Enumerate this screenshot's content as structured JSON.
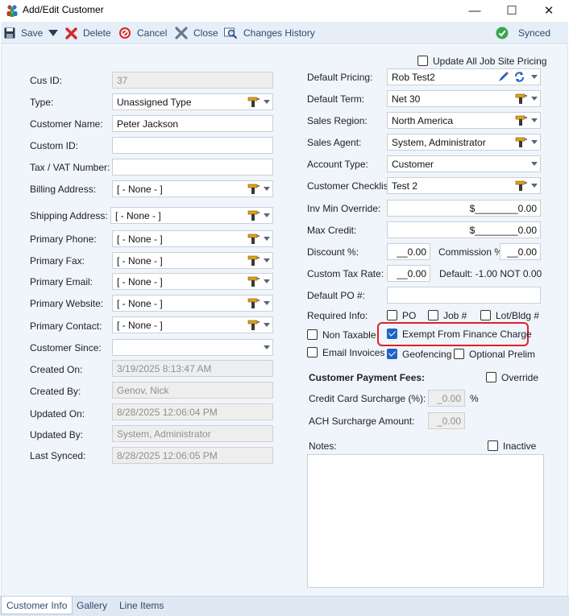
{
  "window": {
    "title": "Add/Edit Customer",
    "minimize_glyph": "—",
    "maximize_glyph": "☐",
    "close_glyph": "✕"
  },
  "toolbar": {
    "save": "Save",
    "delete": "Delete",
    "cancel": "Cancel",
    "close": "Close",
    "changes_history": "Changes History",
    "status": "Synced"
  },
  "update_all_job_site_pricing": {
    "label": "Update All Job Site Pricing",
    "checked": false
  },
  "left": {
    "cus_id": {
      "label": "Cus ID:",
      "value": "37"
    },
    "type": {
      "label": "Type:",
      "value": "Unassigned Type"
    },
    "customer_name": {
      "label": "Customer Name:",
      "value": "Peter Jackson"
    },
    "custom_id": {
      "label": "Custom ID:",
      "value": ""
    },
    "tax_vat": {
      "label": "Tax / VAT Number:",
      "value": ""
    },
    "billing_address": {
      "label": "Billing Address:",
      "value": "[ - None - ]"
    },
    "shipping_address": {
      "label": "Shipping Address:",
      "value": "[ - None - ]"
    },
    "primary_phone": {
      "label": "Primary Phone:",
      "value": "[ - None - ]"
    },
    "primary_fax": {
      "label": "Primary Fax:",
      "value": "[ - None - ]"
    },
    "primary_email": {
      "label": "Primary Email:",
      "value": "[ - None - ]"
    },
    "primary_website": {
      "label": "Primary Website:",
      "value": "[ - None - ]"
    },
    "primary_contact": {
      "label": "Primary Contact:",
      "value": "[ - None - ]"
    },
    "customer_since": {
      "label": "Customer Since:",
      "value": ""
    },
    "created_on": {
      "label": "Created On:",
      "value": "3/19/2025 8:13:47 AM"
    },
    "created_by": {
      "label": "Created By:",
      "value": "Genov, Nick"
    },
    "updated_on": {
      "label": "Updated On:",
      "value": "8/28/2025 12:06:04 PM"
    },
    "updated_by": {
      "label": "Updated By:",
      "value": "System, Administrator"
    },
    "last_synced": {
      "label": "Last Synced:",
      "value": "8/28/2025 12:06:05 PM"
    }
  },
  "right": {
    "default_pricing": {
      "label": "Default Pricing:",
      "value": "Rob Test2"
    },
    "default_term": {
      "label": "Default Term:",
      "value": "Net 30"
    },
    "sales_region": {
      "label": "Sales Region:",
      "value": "North America"
    },
    "sales_agent": {
      "label": "Sales Agent:",
      "value": "System, Administrator"
    },
    "account_type": {
      "label": "Account Type:",
      "value": "Customer"
    },
    "customer_checklist": {
      "label": "Customer Checklist:",
      "value": "Test 2"
    },
    "inv_min_override": {
      "label": "Inv Min Override:",
      "value": "$________0.00"
    },
    "max_credit": {
      "label": "Max Credit:",
      "value": "$________0.00"
    },
    "discount": {
      "label": "Discount %:",
      "value": "__0.00"
    },
    "commission": {
      "label": "Commission %:",
      "value": "__0.00"
    },
    "custom_tax_rate": {
      "label": "Custom Tax Rate:",
      "value": "__0.00",
      "default_note": "Default: -1.00 NOT 0.00"
    },
    "default_po": {
      "label": "Default PO #:",
      "value": ""
    },
    "required_info": {
      "label": "Required Info:",
      "po": "PO",
      "job": "Job #",
      "lot": "Lot/Bldg #",
      "po_checked": false,
      "job_checked": false,
      "lot_checked": false
    },
    "non_taxable": {
      "label": "Non Taxable",
      "checked": false
    },
    "exempt_finance": {
      "label": "Exempt From Finance Charge",
      "checked": true
    },
    "email_invoices": {
      "label": "Email Invoices",
      "checked": false
    },
    "geofencing": {
      "label": "Geofencing",
      "checked": true
    },
    "optional_prelim": {
      "label": "Optional Prelim",
      "checked": false
    },
    "payment_fees": {
      "heading": "Customer Payment Fees:",
      "override": "Override",
      "cc_label": "Credit Card Surcharge (%):",
      "cc_value": "_0.00",
      "cc_unit": "%",
      "ach_label": "ACH Surcharge Amount:",
      "ach_value": "_0.00"
    },
    "notes": {
      "label": "Notes:",
      "value": ""
    },
    "inactive": {
      "label": "Inactive",
      "checked": false
    }
  },
  "tabs": [
    "Customer Info",
    "Gallery",
    "Line Items"
  ],
  "active_tab": "Customer Info",
  "colors": {
    "accent": "#1f63c6",
    "highlight": "#e0202a",
    "synced": "#3aa64a",
    "toolbar_text": "#2f4a6b"
  }
}
